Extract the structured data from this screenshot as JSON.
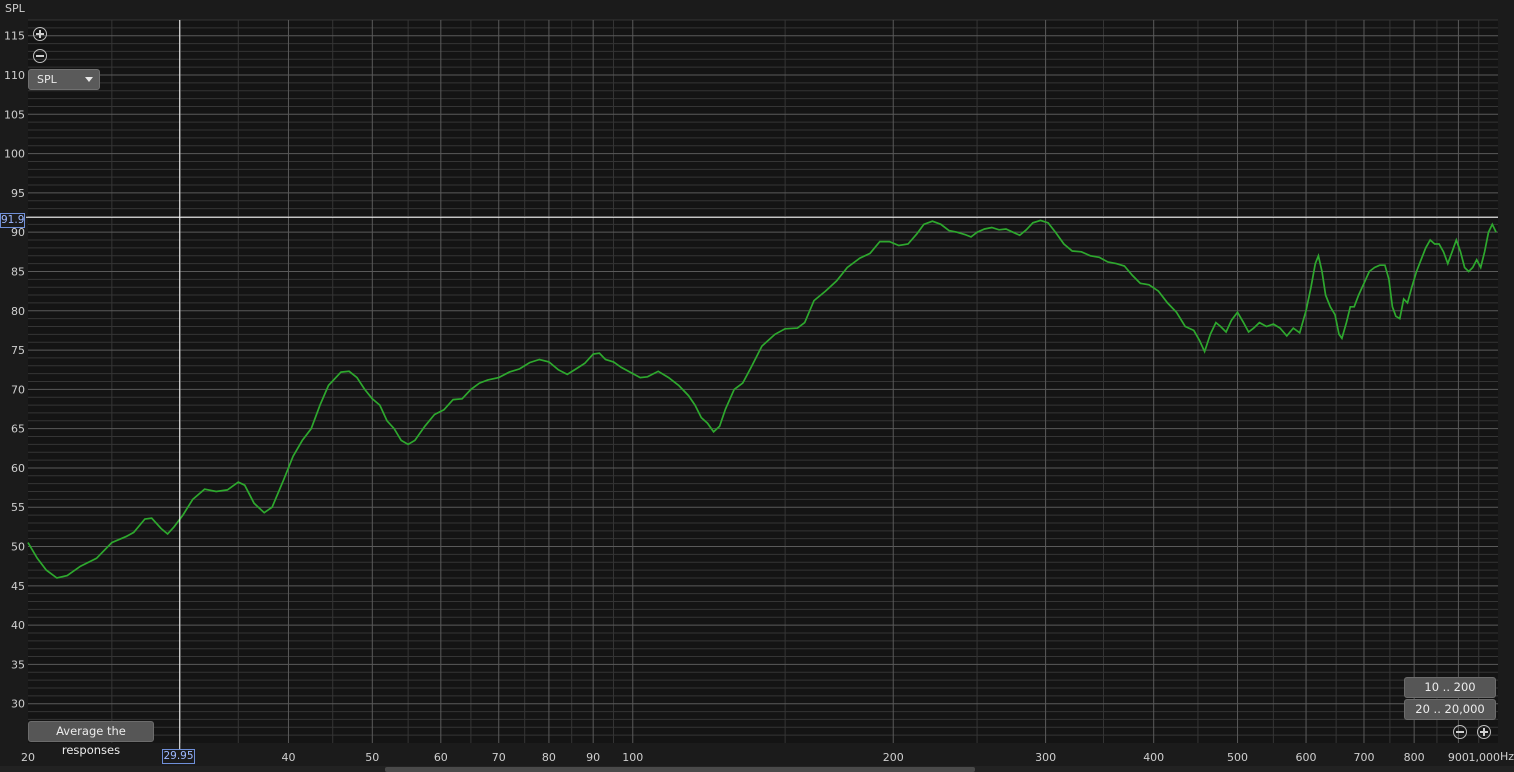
{
  "header": {
    "axis_title": "SPL"
  },
  "controls": {
    "dropdown_label": "SPL",
    "average_button": "Average the responses",
    "range_10_200": "10 .. 200",
    "range_20_20000": "20 .. 20,000",
    "x_unit": "Hz"
  },
  "cursor": {
    "x_value": 29.95,
    "x_label": "29.95",
    "y_value": 91.9,
    "y_label": "91.9"
  },
  "colors": {
    "background": "#1b1b1b",
    "grid_major": "#5a5a5a",
    "grid_minor": "#353535",
    "trace": "#2ea82e",
    "cursor": "#ffffff",
    "cursor_tag": "#9db8ff"
  },
  "chart_data": {
    "type": "line",
    "x_scale": "log",
    "xlim": [
      20,
      1000
    ],
    "ylim": [
      25,
      117
    ],
    "y_ticks": [
      30,
      35,
      40,
      45,
      50,
      55,
      60,
      65,
      70,
      75,
      80,
      85,
      90,
      95,
      100,
      105,
      110,
      115
    ],
    "x_ticks": [
      {
        "v": 20,
        "label": "20"
      },
      {
        "v": 40,
        "label": "40"
      },
      {
        "v": 50,
        "label": "50"
      },
      {
        "v": 60,
        "label": "60"
      },
      {
        "v": 70,
        "label": "70"
      },
      {
        "v": 80,
        "label": "80"
      },
      {
        "v": 90,
        "label": "90"
      },
      {
        "v": 100,
        "label": "100"
      },
      {
        "v": 200,
        "label": "200"
      },
      {
        "v": 300,
        "label": "300"
      },
      {
        "v": 400,
        "label": "400"
      },
      {
        "v": 500,
        "label": "500"
      },
      {
        "v": 600,
        "label": "600"
      },
      {
        "v": 700,
        "label": "700"
      },
      {
        "v": 800,
        "label": "800"
      },
      {
        "v": 900,
        "label": "900"
      },
      {
        "v": 1000,
        "label": "1,000"
      }
    ],
    "series": [
      {
        "points": [
          [
            20,
            50.5
          ],
          [
            20.5,
            48.5
          ],
          [
            21,
            47
          ],
          [
            21.6,
            46
          ],
          [
            22.2,
            46.3
          ],
          [
            23,
            47.5
          ],
          [
            24,
            48.5
          ],
          [
            25,
            50.5
          ],
          [
            26,
            51.3
          ],
          [
            26.5,
            51.8
          ],
          [
            27.3,
            53.5
          ],
          [
            27.8,
            53.6
          ],
          [
            28.5,
            52.3
          ],
          [
            29,
            51.6
          ],
          [
            29.5,
            52.5
          ],
          [
            30.2,
            54
          ],
          [
            31,
            56
          ],
          [
            32,
            57.3
          ],
          [
            33,
            57
          ],
          [
            34,
            57.2
          ],
          [
            35,
            58.2
          ],
          [
            35.6,
            57.8
          ],
          [
            36.5,
            55.5
          ],
          [
            37.5,
            54.3
          ],
          [
            38.3,
            55
          ],
          [
            39.5,
            58.5
          ],
          [
            40.5,
            61.5
          ],
          [
            41.5,
            63.5
          ],
          [
            42.5,
            65
          ],
          [
            43.5,
            68
          ],
          [
            44.5,
            70.5
          ],
          [
            46,
            72.2
          ],
          [
            47,
            72.3
          ],
          [
            48,
            71.5
          ],
          [
            49,
            70
          ],
          [
            50,
            68.8
          ],
          [
            51,
            68
          ],
          [
            52,
            66
          ],
          [
            53,
            65
          ],
          [
            54,
            63.5
          ],
          [
            55,
            63
          ],
          [
            56,
            63.5
          ],
          [
            57.5,
            65.3
          ],
          [
            59,
            66.8
          ],
          [
            60.5,
            67.4
          ],
          [
            62,
            68.7
          ],
          [
            63.5,
            68.8
          ],
          [
            65,
            70
          ],
          [
            66.5,
            70.8
          ],
          [
            68,
            71.2
          ],
          [
            70,
            71.5
          ],
          [
            72,
            72.2
          ],
          [
            74,
            72.6
          ],
          [
            76,
            73.4
          ],
          [
            78,
            73.8
          ],
          [
            80,
            73.5
          ],
          [
            82,
            72.5
          ],
          [
            84,
            71.9
          ],
          [
            86,
            72.6
          ],
          [
            88,
            73.3
          ],
          [
            90,
            74.5
          ],
          [
            91.5,
            74.6
          ],
          [
            93,
            73.8
          ],
          [
            95,
            73.5
          ],
          [
            97,
            72.8
          ],
          [
            100,
            72
          ],
          [
            102,
            71.5
          ],
          [
            104,
            71.6
          ],
          [
            107,
            72.3
          ],
          [
            110,
            71.5
          ],
          [
            113,
            70.5
          ],
          [
            116,
            69.2
          ],
          [
            118,
            68
          ],
          [
            120,
            66.4
          ],
          [
            122,
            65.7
          ],
          [
            124,
            64.6
          ],
          [
            126,
            65.3
          ],
          [
            128,
            67.5
          ],
          [
            131,
            70
          ],
          [
            134,
            70.8
          ],
          [
            137,
            72.8
          ],
          [
            141,
            75.5
          ],
          [
            146,
            77
          ],
          [
            150,
            77.7
          ],
          [
            155,
            77.8
          ],
          [
            158,
            78.5
          ],
          [
            162,
            81.3
          ],
          [
            167,
            82.5
          ],
          [
            172,
            83.8
          ],
          [
            177,
            85.5
          ],
          [
            183,
            86.7
          ],
          [
            188,
            87.3
          ],
          [
            193,
            88.8
          ],
          [
            198,
            88.8
          ],
          [
            203,
            88.3
          ],
          [
            208,
            88.5
          ],
          [
            213,
            89.8
          ],
          [
            217,
            91
          ],
          [
            222,
            91.4
          ],
          [
            227,
            91
          ],
          [
            232,
            90.2
          ],
          [
            237,
            90
          ],
          [
            242,
            89.7
          ],
          [
            246,
            89.4
          ],
          [
            250,
            90
          ],
          [
            255,
            90.4
          ],
          [
            260,
            90.6
          ],
          [
            265,
            90.3
          ],
          [
            270,
            90.4
          ],
          [
            275,
            90
          ],
          [
            280,
            89.6
          ],
          [
            285,
            90.3
          ],
          [
            290,
            91.2
          ],
          [
            296,
            91.5
          ],
          [
            302,
            91.2
          ],
          [
            308,
            90
          ],
          [
            315,
            88.5
          ],
          [
            322,
            87.6
          ],
          [
            330,
            87.5
          ],
          [
            338,
            87
          ],
          [
            346,
            86.8
          ],
          [
            354,
            86.2
          ],
          [
            362,
            86
          ],
          [
            370,
            85.7
          ],
          [
            378,
            84.5
          ],
          [
            386,
            83.5
          ],
          [
            395,
            83.3
          ],
          [
            405,
            82.5
          ],
          [
            415,
            81
          ],
          [
            425,
            79.8
          ],
          [
            435,
            78
          ],
          [
            445,
            77.5
          ],
          [
            452,
            76.2
          ],
          [
            458,
            74.8
          ],
          [
            465,
            77
          ],
          [
            472,
            78.5
          ],
          [
            478,
            78
          ],
          [
            485,
            77.3
          ],
          [
            492,
            78.8
          ],
          [
            500,
            79.8
          ],
          [
            508,
            78.5
          ],
          [
            515,
            77.3
          ],
          [
            522,
            77.8
          ],
          [
            530,
            78.5
          ],
          [
            540,
            78
          ],
          [
            550,
            78.3
          ],
          [
            560,
            77.8
          ],
          [
            570,
            76.8
          ],
          [
            580,
            77.8
          ],
          [
            590,
            77.2
          ],
          [
            600,
            80
          ],
          [
            608,
            83
          ],
          [
            615,
            86
          ],
          [
            620,
            87
          ],
          [
            626,
            85
          ],
          [
            632,
            82
          ],
          [
            640,
            80.5
          ],
          [
            648,
            79.5
          ],
          [
            655,
            77
          ],
          [
            660,
            76.5
          ],
          [
            668,
            78.5
          ],
          [
            675,
            80.5
          ],
          [
            682,
            80.5
          ],
          [
            690,
            82
          ],
          [
            700,
            83.5
          ],
          [
            710,
            85
          ],
          [
            720,
            85.5
          ],
          [
            730,
            85.8
          ],
          [
            740,
            85.8
          ],
          [
            748,
            84
          ],
          [
            755,
            80.5
          ],
          [
            762,
            79.3
          ],
          [
            770,
            79
          ],
          [
            778,
            81.5
          ],
          [
            786,
            81
          ],
          [
            795,
            83
          ],
          [
            805,
            85
          ],
          [
            815,
            86.5
          ],
          [
            825,
            88
          ],
          [
            835,
            89
          ],
          [
            845,
            88.5
          ],
          [
            855,
            88.5
          ],
          [
            865,
            87.5
          ],
          [
            875,
            86
          ],
          [
            885,
            87.5
          ],
          [
            895,
            89
          ],
          [
            905,
            87.5
          ],
          [
            915,
            85.5
          ],
          [
            925,
            85
          ],
          [
            935,
            85.5
          ],
          [
            945,
            86.5
          ],
          [
            955,
            85.5
          ],
          [
            965,
            87.5
          ],
          [
            975,
            90
          ],
          [
            985,
            91
          ],
          [
            995,
            90
          ]
        ]
      }
    ]
  }
}
